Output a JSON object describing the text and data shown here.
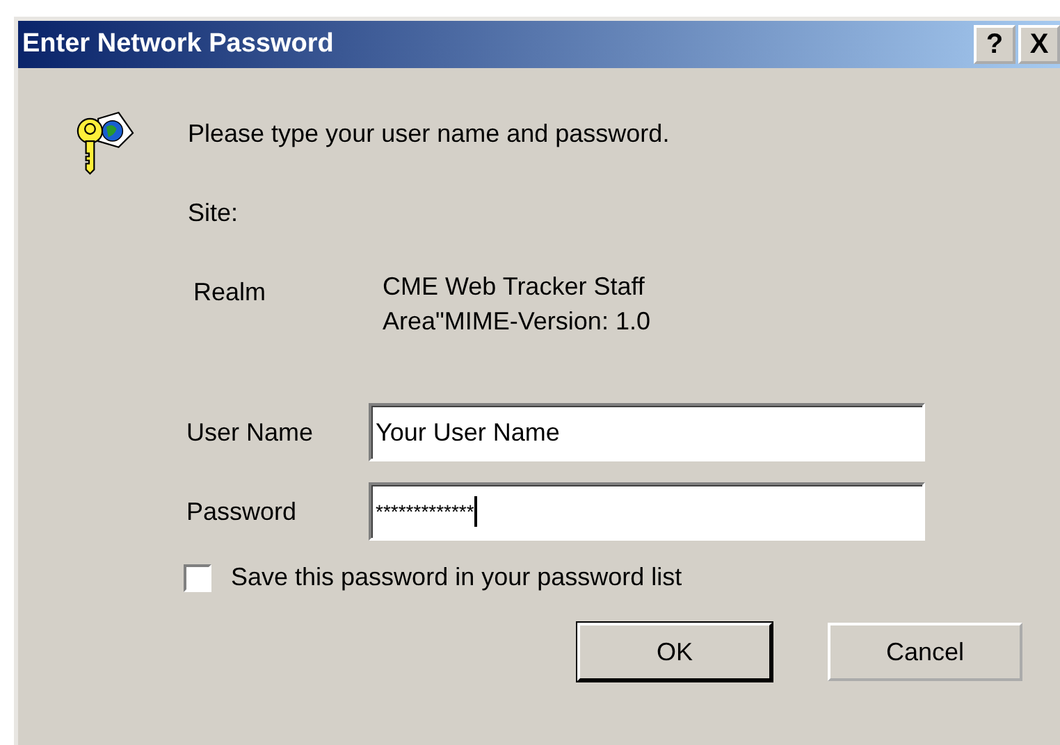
{
  "window": {
    "title": "Enter Network Password",
    "title_buttons": [
      "?",
      "X"
    ]
  },
  "prompt": "Please type your user name and password.",
  "site": {
    "label": "Site:"
  },
  "realm": {
    "label": "Realm",
    "value_lines": [
      "CME Web Tracker Staff",
      "Area\"MIME-Version: 1.0"
    ]
  },
  "fields": [
    {
      "label": "User Name",
      "value": "Your User Name",
      "focused": false
    },
    {
      "label": "Password",
      "value": "*************",
      "focused": true
    }
  ],
  "save_password": {
    "label": "Save this password in your password list",
    "checked": false
  },
  "buttons": [
    {
      "label": "OK",
      "default": true
    },
    {
      "label": "Cancel",
      "default": false
    }
  ]
}
